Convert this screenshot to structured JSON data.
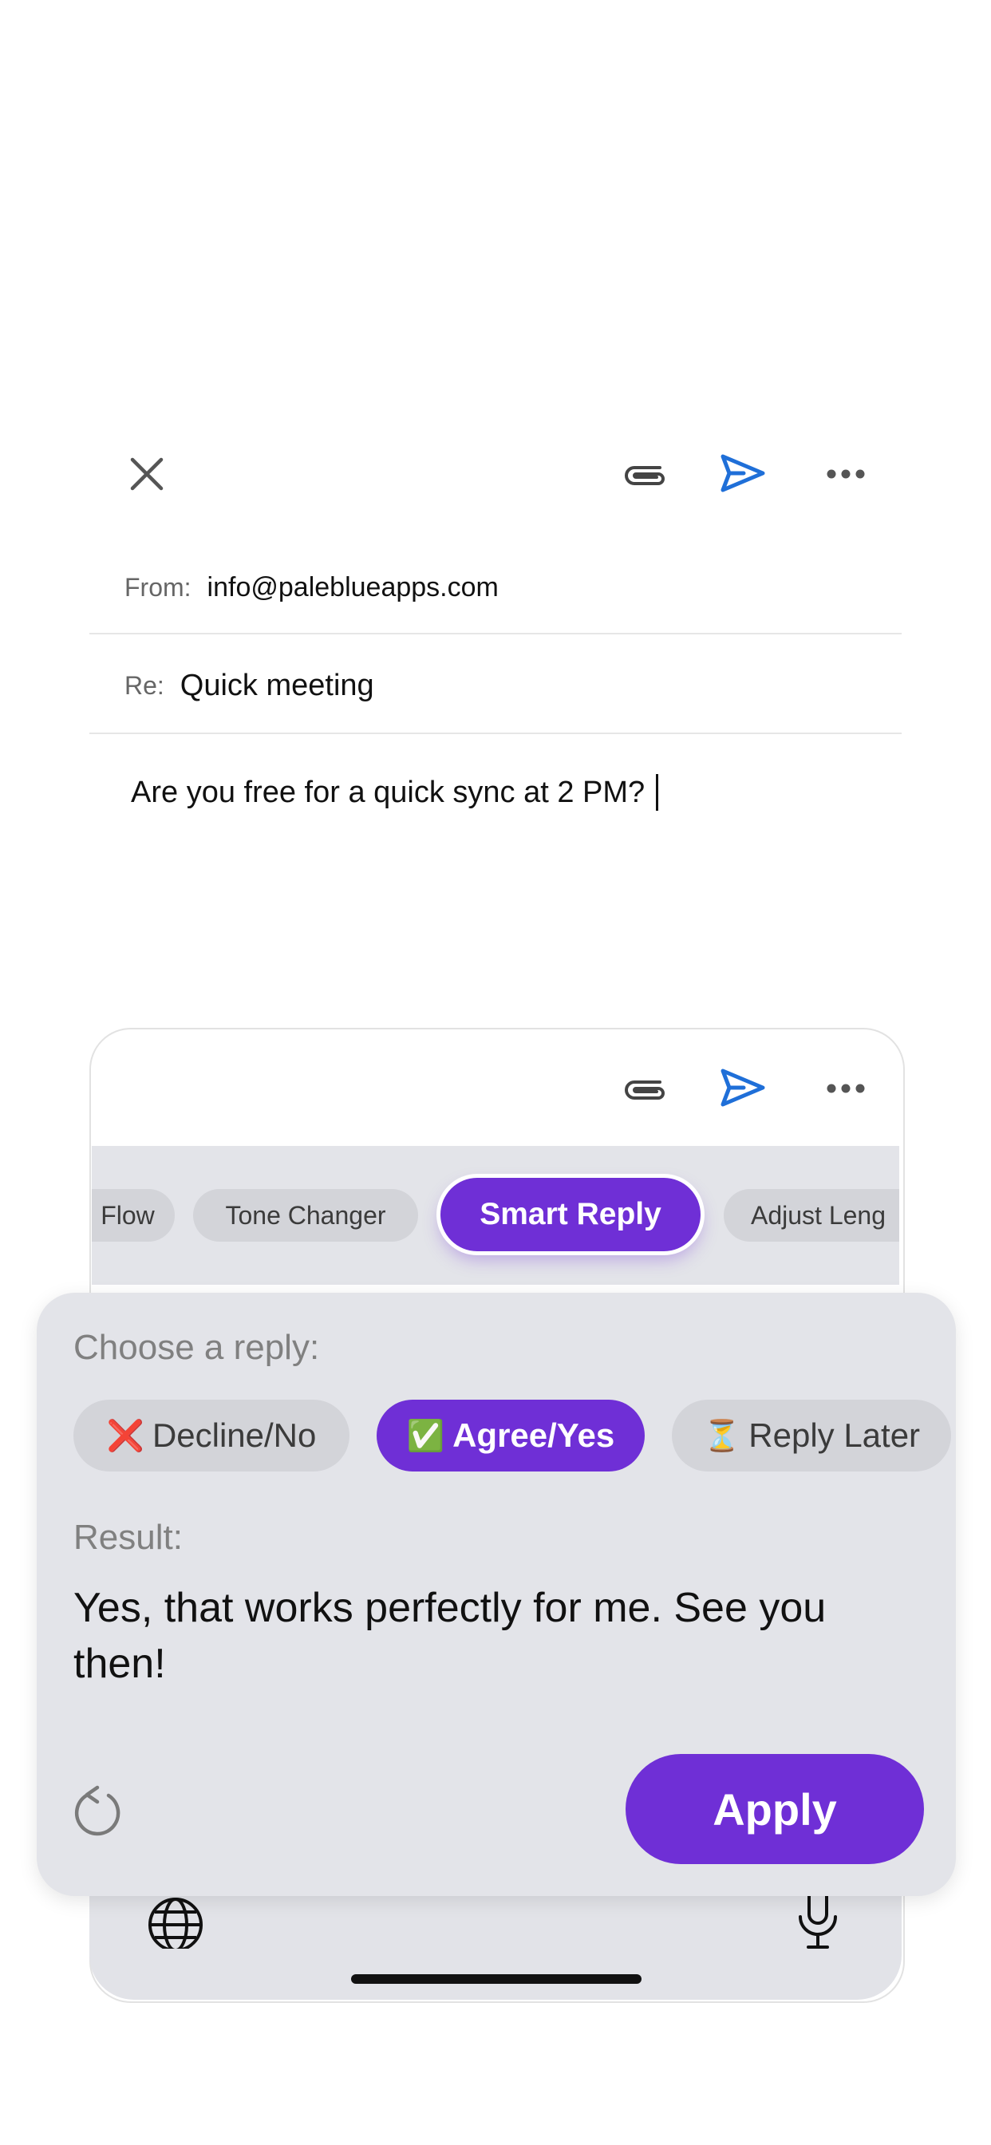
{
  "compose": {
    "from_label": "From:",
    "from_value": "info@paleblueapps.com",
    "subject_label": "Re:",
    "subject_value": "Quick meeting",
    "body": "Are you free for a quick sync at 2 PM?"
  },
  "toolbar": {
    "close_icon": "close-icon",
    "attach_icon": "paperclip-icon",
    "send_icon": "send-icon",
    "more_icon": "more-horizontal-icon"
  },
  "keyboard": {
    "chips": [
      {
        "label": "Flow"
      },
      {
        "label": "Tone Changer"
      },
      {
        "label": "Smart Reply",
        "active": true
      },
      {
        "label": "Adjust Leng"
      }
    ],
    "globe_icon": "globe-icon",
    "mic_icon": "microphone-icon"
  },
  "smart_reply": {
    "choose_label": "Choose a reply:",
    "options": [
      {
        "emoji": "❌",
        "label": "Decline/No"
      },
      {
        "emoji": "✅",
        "label": "Agree/Yes",
        "active": true
      },
      {
        "emoji": "⏳",
        "label": "Reply Later"
      }
    ],
    "result_label": "Result:",
    "result_text": "Yes, that works perfectly for me. See you then!",
    "apply_label": "Apply",
    "refresh_icon": "refresh-icon"
  },
  "colors": {
    "accent": "#6f2fd6",
    "send_blue": "#1f6fd8",
    "panel_bg": "#e3e4e9",
    "chip_bg": "#d3d4d9"
  }
}
